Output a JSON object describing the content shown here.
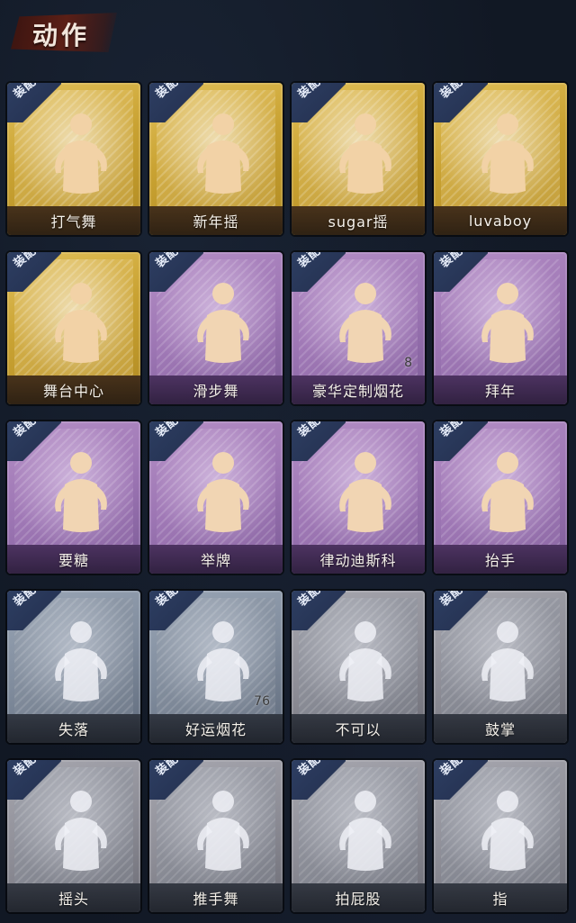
{
  "header": {
    "title": "动作"
  },
  "equip_label": "装配",
  "cards": [
    {
      "name": "打气舞",
      "tier": "gold",
      "icon": "dance-figure-icon",
      "count": ""
    },
    {
      "name": "新年摇",
      "tier": "gold",
      "icon": "dance-figure-icon",
      "count": ""
    },
    {
      "name": "sugar摇",
      "tier": "gold",
      "icon": "dance-figure-icon",
      "count": ""
    },
    {
      "name": "luvaboy",
      "tier": "gold",
      "icon": "dance-figure-icon",
      "count": ""
    },
    {
      "name": "舞台中心",
      "tier": "gold",
      "icon": "dance-figure-icon",
      "count": ""
    },
    {
      "name": "滑步舞",
      "tier": "purple",
      "icon": "dance-figure-icon",
      "count": ""
    },
    {
      "name": "豪华定制烟花",
      "tier": "purple",
      "icon": "fireworks-box-icon",
      "count": "8"
    },
    {
      "name": "拜年",
      "tier": "purple",
      "icon": "bow-figure-icon",
      "count": ""
    },
    {
      "name": "要糖",
      "tier": "purple",
      "icon": "beg-figure-icon",
      "count": ""
    },
    {
      "name": "举牌",
      "tier": "purple",
      "icon": "sign-figure-icon",
      "count": ""
    },
    {
      "name": "律动迪斯科",
      "tier": "purple",
      "icon": "disco-figure-icon",
      "count": ""
    },
    {
      "name": "抬手",
      "tier": "purple",
      "icon": "raise-hand-figure-icon",
      "count": ""
    },
    {
      "name": "失落",
      "tier": "silver",
      "icon": "crawl-figure-icon",
      "count": ""
    },
    {
      "name": "好运烟花",
      "tier": "silver",
      "icon": "firework-can-icon",
      "count": "76"
    },
    {
      "name": "不可以",
      "tier": "gray",
      "icon": "finger-wag-icon",
      "count": ""
    },
    {
      "name": "鼓掌",
      "tier": "gray",
      "icon": "clap-hands-icon",
      "count": ""
    },
    {
      "name": "摇头",
      "tier": "gray",
      "icon": "shake-head-figure-icon",
      "count": ""
    },
    {
      "name": "推手舞",
      "tier": "gray",
      "icon": "push-dance-figure-icon",
      "count": ""
    },
    {
      "name": "拍屁股",
      "tier": "gray",
      "icon": "walk-figure-icon",
      "count": ""
    },
    {
      "name": "指",
      "tier": "gray",
      "icon": "point-hand-icon",
      "count": ""
    }
  ]
}
